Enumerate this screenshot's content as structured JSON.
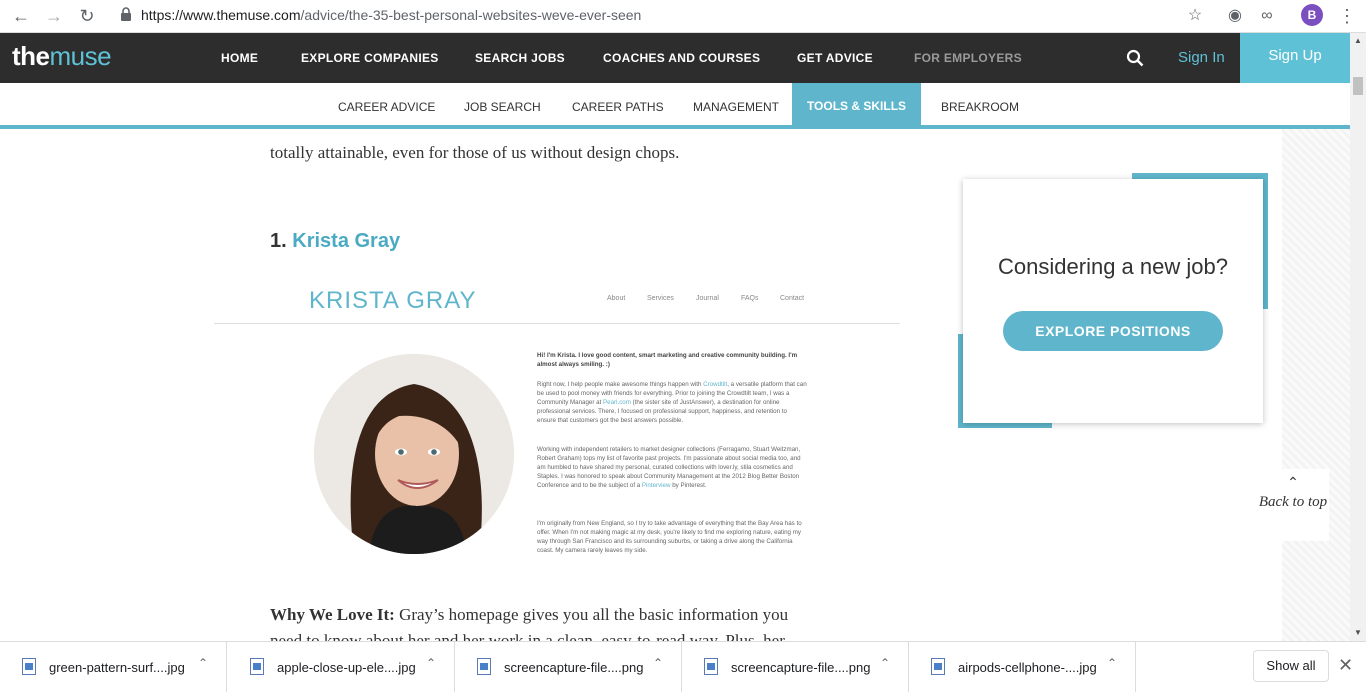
{
  "browser": {
    "url_host": "https://www.themuse.com",
    "url_path": "/advice/the-35-best-personal-websites-weve-ever-seen",
    "profile_initial": "B"
  },
  "header": {
    "logo_the": "the",
    "logo_muse": "muse",
    "nav": [
      "HOME",
      "EXPLORE COMPANIES",
      "SEARCH JOBS",
      "COACHES AND COURSES",
      "GET ADVICE",
      "FOR EMPLOYERS"
    ],
    "sign_in": "Sign In",
    "sign_up": "Sign Up"
  },
  "subnav": {
    "items": [
      "CAREER ADVICE",
      "JOB SEARCH",
      "CAREER PATHS",
      "MANAGEMENT",
      "TOOLS & SKILLS",
      "BREAKROOM"
    ],
    "active": "TOOLS & SKILLS"
  },
  "article": {
    "intro_tail": "totally attainable, even for those of us without design chops.",
    "item_number": "1.",
    "item_name": "Krista Gray",
    "why_label": "Why We Love It:",
    "why_text": " Gray’s homepage gives you all the basic information you",
    "why_text_2": "need to know about her and her work in a clean, easy-to-read way. Plus, her"
  },
  "screenshot": {
    "title": "KRISTA GRAY",
    "nav": [
      "About",
      "Services",
      "Journal",
      "FAQs",
      "Contact"
    ],
    "intro": "Hi! I'm Krista. I love good content, smart marketing and creative community building. I'm almost always smiling. :)",
    "p1a": "Right now, I help people make awesome things happen with ",
    "p1_link": "Crowdtilt",
    "p1b": ", a versatile platform that can be used to pool money with friends for everything. Prior to joining the Crowdtilt team, I was a Community Manager at ",
    "p1_link2": "Pearl.com",
    "p1c": " (the sister site of JustAnswer), a destination for online professional services. There, I focused on professional support, happiness, and retention to ensure that customers got the best answers possible.",
    "p2a": "Working with independent retailers to market designer collections (Ferragamo, Stuart Weitzman, Robert Graham) tops my list of favorite past projects. I'm passionate about social media too, and am humbled to have shared my personal, curated collections with lover.ly, stila cosmetics and Staples. I was honored to speak about Community Management at the 2012 Blog Better Boston Conference and to be the subject of a ",
    "p2_link": "Pinterview",
    "p2b": " by Pinterest.",
    "p3": "I'm originally from New England, so I try to take advantage of everything that the Bay Area has to offer. When I'm not making magic at my desk, you're likely to find me exploring nature, eating my way through San Francisco and its surrounding suburbs, or taking a drive along the California coast.  My camera rarely leaves my side."
  },
  "sidebar": {
    "card_title": "Considering a new job?",
    "card_button": "EXPLORE POSITIONS",
    "back_to_top": "Back to top"
  },
  "downloads": {
    "files": [
      "green-pattern-surf....jpg",
      "apple-close-up-ele....jpg",
      "screencapture-file....png",
      "screencapture-file....png",
      "airpods-cellphone-....jpg"
    ],
    "show_all": "Show all"
  },
  "colors": {
    "brand": "#5fc1d6",
    "header_bg": "#2d2d2d",
    "accent": "#5fb6cc"
  }
}
